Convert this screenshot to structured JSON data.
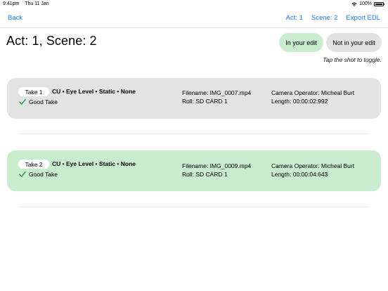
{
  "status_bar": {
    "time": "9:41pm",
    "date": "Thu 11 Jan",
    "battery": "100%",
    "battery_level": 1.0,
    "wifi_icon": "wifi-icon",
    "battery_icon": "battery-icon"
  },
  "nav": {
    "back_label": "Back",
    "act_label": "Act: 1",
    "scene_label": "Scene: 2",
    "export_label": "Export EDL",
    "accent_color": "#1677ff"
  },
  "page": {
    "title": "Act: 1, Scene: 2"
  },
  "filter": {
    "in_edit_label": "In your edit",
    "not_in_edit_label": "Not in your edit",
    "hint": "Tap the shot to toggle.",
    "in_edit_color": "#c9eccf",
    "not_in_edit_color": "#e2e2e2"
  },
  "takes": [
    {
      "take_label": "Take 1",
      "shot_description": "CU • Eye Level • Static • None",
      "quality_label": "Good Take",
      "quality_icon": "checkmark-icon",
      "filename": "Filename: IMG_0007.mp4",
      "roll": "Roll: SD CARD 1",
      "camera_operator": "Camera Operator: Micheal Burt",
      "length": "Length: 00:00:02:992",
      "in_edit": false
    },
    {
      "take_label": "Take 2",
      "shot_description": "CU • Eye Level • Static • None",
      "quality_label": "Good Take",
      "quality_icon": "checkmark-icon",
      "filename": "Filename: IMG_0009.mp4",
      "roll": "Roll: SD CARD 1",
      "camera_operator": "Camera Operator: Micheal Burt",
      "length": "Length: 00:00:04:643",
      "in_edit": true
    }
  ],
  "colors": {
    "check_green": "#2ea043"
  }
}
